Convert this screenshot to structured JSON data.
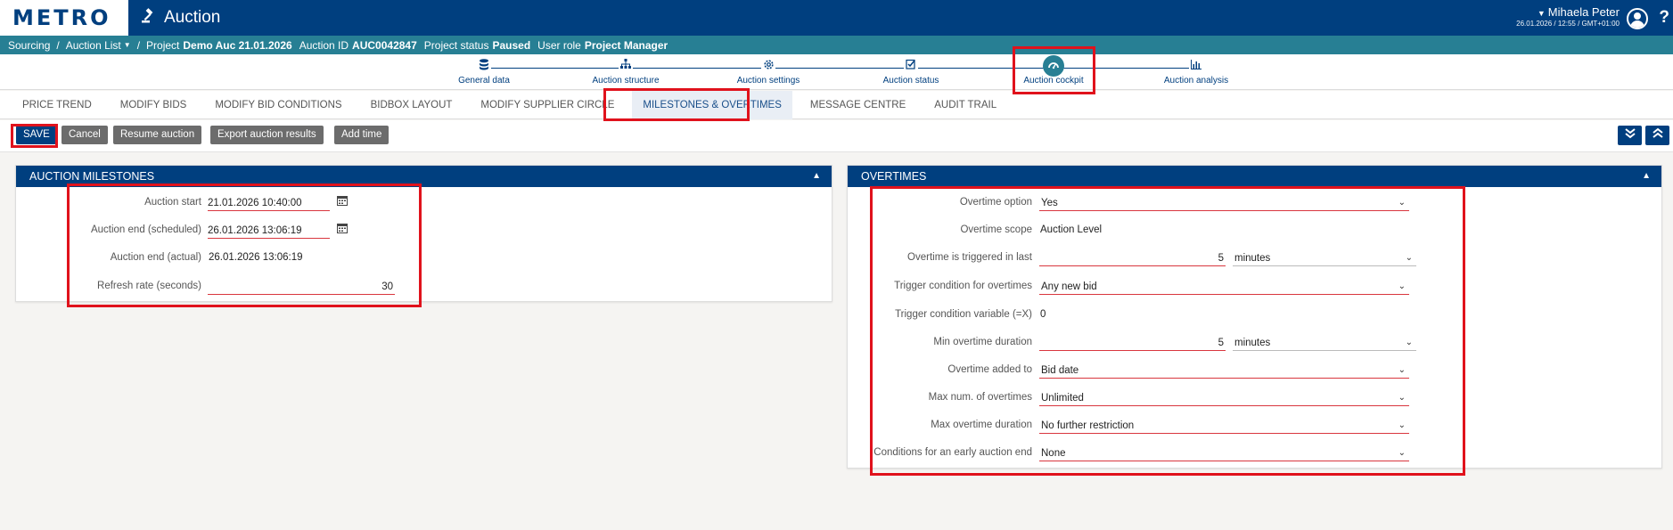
{
  "app": {
    "logo": "METRO",
    "title": "Auction"
  },
  "user": {
    "name": "Mihaela Peter",
    "meta": "26.01.2026 / 12:55 / GMT+01:00"
  },
  "help_label": "?",
  "context": {
    "sourcing": "Sourcing",
    "sep": "/",
    "auction_list": "Auction List",
    "project_label": "Project",
    "project_value": "Demo Auc 21.01.2026",
    "auction_id_label": "Auction ID",
    "auction_id_value": "AUC0042847",
    "status_label": "Project status",
    "status_value": "Paused",
    "role_label": "User role",
    "role_value": "Project Manager"
  },
  "steps": [
    {
      "label": "General data",
      "icon": "database-icon"
    },
    {
      "label": "Auction structure",
      "icon": "hierarchy-icon"
    },
    {
      "label": "Auction settings",
      "icon": "gear-icon"
    },
    {
      "label": "Auction status",
      "icon": "checklist-icon"
    },
    {
      "label": "Auction cockpit",
      "icon": "speedometer-icon",
      "active": true
    },
    {
      "label": "Auction analysis",
      "icon": "bar-chart-icon"
    }
  ],
  "tabs": [
    {
      "label": "PRICE TREND"
    },
    {
      "label": "MODIFY BIDS"
    },
    {
      "label": "MODIFY BID CONDITIONS"
    },
    {
      "label": "BIDBOX LAYOUT"
    },
    {
      "label": "MODIFY SUPPLIER CIRCLE"
    },
    {
      "label": "MILESTONES & OVERTIMES",
      "active": true
    },
    {
      "label": "MESSAGE CENTRE"
    },
    {
      "label": "AUDIT TRAIL"
    }
  ],
  "actions": {
    "save": "SAVE",
    "cancel": "Cancel",
    "resume": "Resume auction",
    "export": "Export auction results",
    "add_time": "Add time"
  },
  "milestones": {
    "title": "AUCTION MILESTONES",
    "auction_start_label": "Auction start",
    "auction_start_value": "21.01.2026 10:40:00",
    "auction_end_sched_label": "Auction end (scheduled)",
    "auction_end_sched_value": "26.01.2026 13:06:19",
    "auction_end_actual_label": "Auction end (actual)",
    "auction_end_actual_value": "26.01.2026 13:06:19",
    "refresh_label": "Refresh rate (seconds)",
    "refresh_value": "30"
  },
  "overtimes": {
    "title": "OVERTIMES",
    "option_label": "Overtime option",
    "option_value": "Yes",
    "scope_label": "Overtime scope",
    "scope_value": "Auction Level",
    "triggered_label": "Overtime is triggered in last",
    "triggered_value": "5",
    "triggered_unit": "minutes",
    "trigger_cond_label": "Trigger condition for overtimes",
    "trigger_cond_value": "Any new bid",
    "trigger_var_label": "Trigger condition variable (=X)",
    "trigger_var_value": "0",
    "min_dur_label": "Min overtime duration",
    "min_dur_value": "5",
    "min_dur_unit": "minutes",
    "added_to_label": "Overtime added to",
    "added_to_value": "Bid date",
    "max_num_label": "Max num. of overtimes",
    "max_num_value": "Unlimited",
    "max_dur_label": "Max overtime duration",
    "max_dur_value": "No further restriction",
    "early_end_label": "Conditions for an early auction end",
    "early_end_value": "None"
  },
  "colors": {
    "brand": "#003f7f",
    "context_bar": "#277f94",
    "highlight": "#e0121c",
    "logo_accent": "#ffd300"
  }
}
